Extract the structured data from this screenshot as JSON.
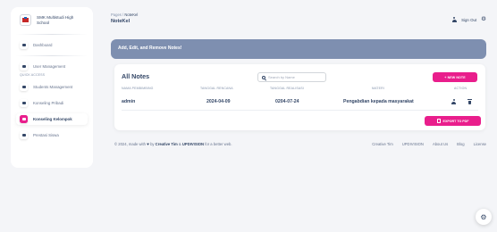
{
  "brand": {
    "name_line1": "SMK Multistudi High",
    "name_line2": "School"
  },
  "sidebar": {
    "items": [
      {
        "label": "Dashboard"
      },
      {
        "label": "User Management"
      },
      {
        "label": "Students Management"
      },
      {
        "label": "Konseling Pribadi"
      },
      {
        "label": "Konseling Kelompok"
      },
      {
        "label": "Prestasi Siswa"
      }
    ],
    "section_label": "QUICK ACCESS",
    "active_index": 4
  },
  "header": {
    "breadcrumb_root": "Pages",
    "breadcrumb_sep": "/",
    "breadcrumb_current": "NoteKel",
    "title": "NoteKel",
    "sign_out": "Sign Out"
  },
  "banner": {
    "text": "Add, Edit, and Remove Notes!"
  },
  "notes": {
    "title": "All Notes",
    "search_placeholder": "Search by Name",
    "new_button": "+ NEW NOTE",
    "export_button": "EXPORT TO PDF",
    "columns": [
      "NAMA PEMBIMBING",
      "TANGGAL RENCANA",
      "TANGGAL REALISASI",
      "MATERI",
      "ACTION"
    ],
    "rows": [
      {
        "pembimbing": "admin",
        "rencana": "2024-04-09",
        "realisasi": "0204-07-24",
        "materi": "Pengabdian kepada masyarakat"
      }
    ]
  },
  "footer": {
    "prefix": "© 2024, made with",
    "by": "by",
    "creative_tim": "Creative Tim",
    "amp": "&",
    "updivision": "UPDIVISION",
    "suffix": "for a better web.",
    "links": [
      "Creative Tim",
      "UPDIVISION",
      "About Us",
      "Blog",
      "License"
    ]
  },
  "colors": {
    "accent": "#e91e8c",
    "banner": "#7e8fb0",
    "text": "#344767",
    "muted": "#8392ab"
  },
  "icons": {
    "brand": "school-logo-icon",
    "dashboard": "dashboard-icon",
    "user_management": "user-plus-icon",
    "students": "list-icon",
    "konseling_pribadi": "person-icon",
    "konseling_kelompok": "group-icon",
    "prestasi": "trophy-icon",
    "search": "search-icon",
    "settings": "gear-icon",
    "sign_out": "user-icon",
    "export": "pdf-icon",
    "edit_user": "user-edit-icon",
    "delete": "trash-icon"
  }
}
